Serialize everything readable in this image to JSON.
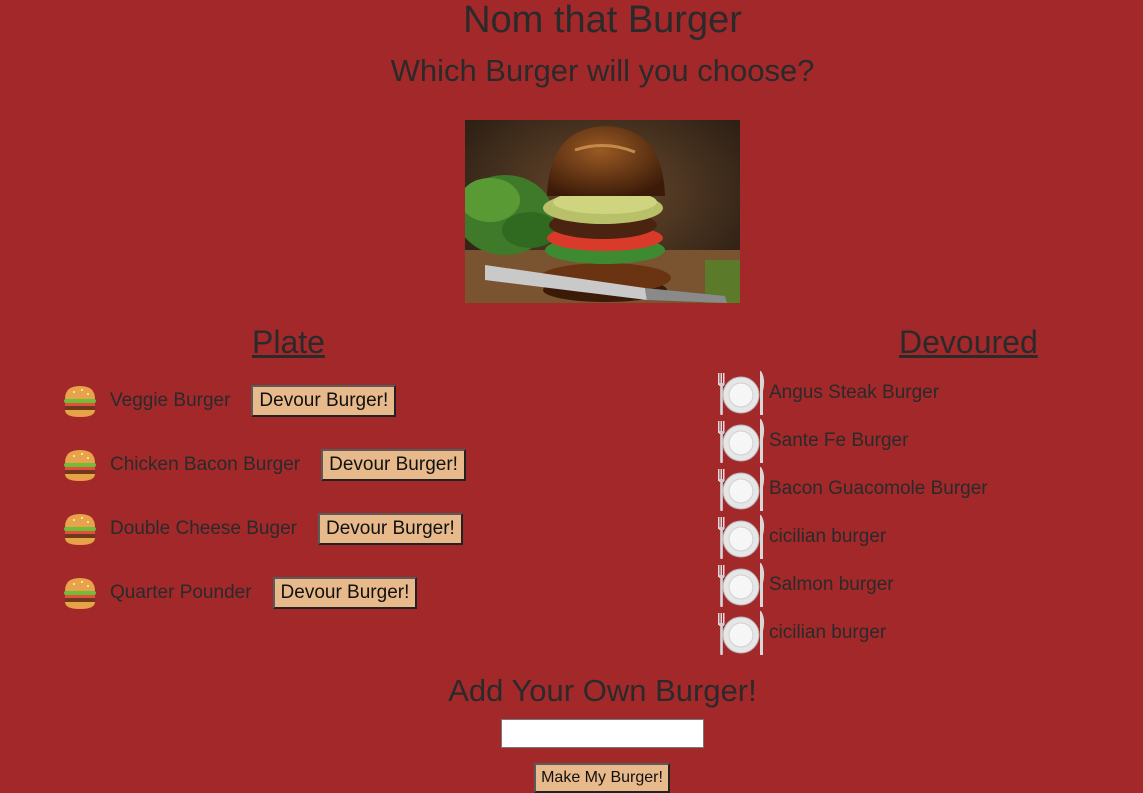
{
  "header": {
    "title": "Nom that Burger",
    "subtitle": "Which Burger will you choose?"
  },
  "hero_image": {
    "icon": "burger-photo"
  },
  "plate": {
    "heading": "Plate",
    "items": [
      {
        "name": "Veggie Burger",
        "button_label": "Devour Burger!"
      },
      {
        "name": "Chicken Bacon Burger",
        "button_label": "Devour Burger!"
      },
      {
        "name": "Double Cheese Buger",
        "button_label": "Devour Burger!"
      },
      {
        "name": "Quarter Pounder",
        "button_label": "Devour Burger!"
      }
    ]
  },
  "devoured": {
    "heading": "Devoured",
    "items": [
      {
        "name": "Angus Steak Burger"
      },
      {
        "name": "Sante Fe Burger"
      },
      {
        "name": "Bacon Guacomole Burger"
      },
      {
        "name": "cicilian burger"
      },
      {
        "name": "Salmon burger"
      },
      {
        "name": "cicilian burger"
      }
    ]
  },
  "add_form": {
    "heading": "Add Your Own Burger!",
    "input_value": "",
    "submit_label": "Make My Burger!"
  },
  "colors": {
    "background": "#a3282a",
    "button": "#e8b98a",
    "text": "#2a2a2a"
  }
}
